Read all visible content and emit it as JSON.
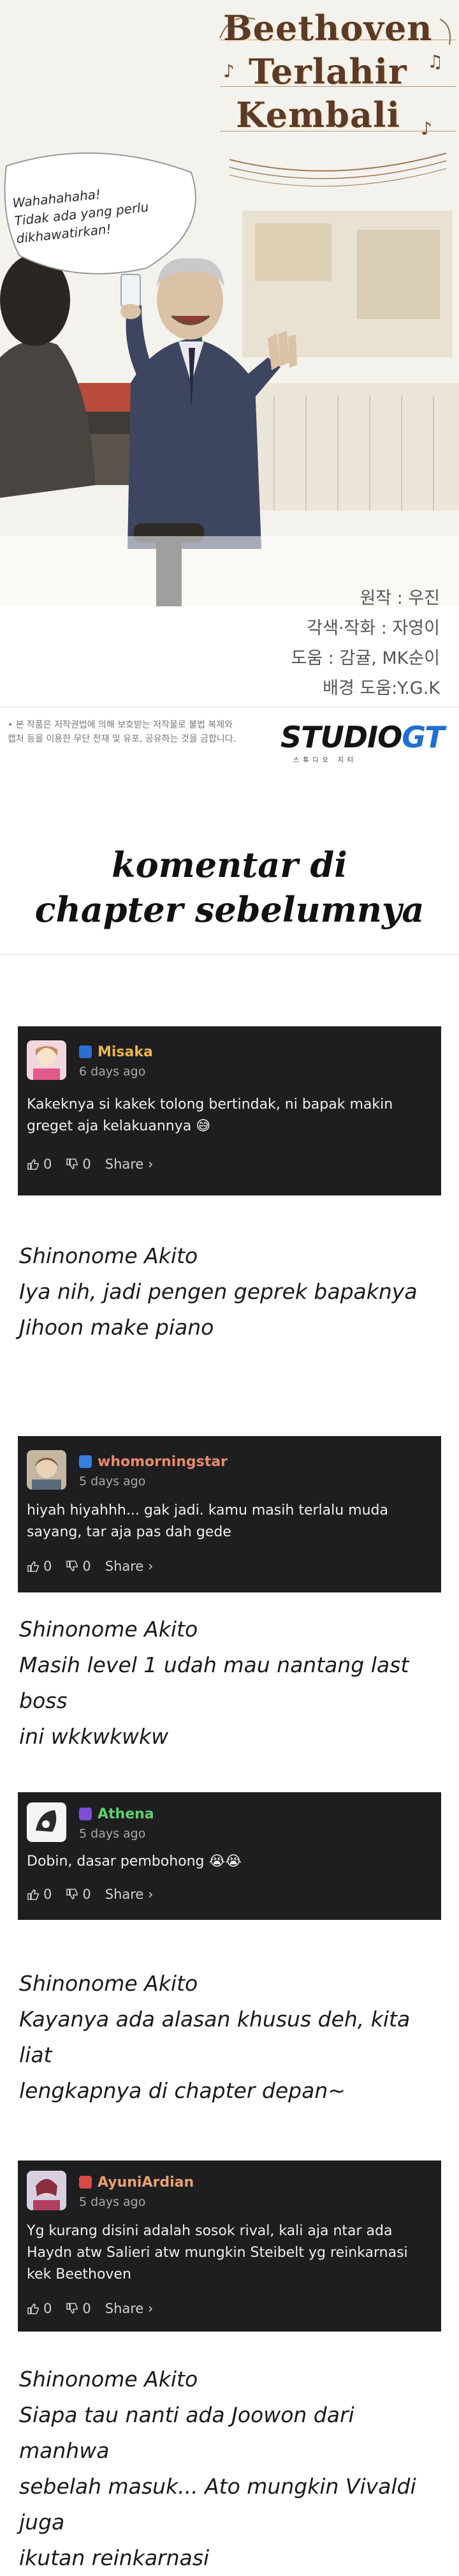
{
  "title_art": {
    "lines": [
      "Beethoven",
      "Terlahir",
      "Kembali"
    ],
    "speech_bubble": [
      "Wahahahaha!",
      "Tidak ada yang perlu",
      "dikhawatirkan!"
    ]
  },
  "credits": [
    "원작 : 우진",
    "각색·작화 : 자영이",
    "도움 : 감귤, MK순이",
    "배경 도움:Y.G.K"
  ],
  "notice": [
    "• 본 작품은 저작권법에 의해 보호받는 저작물로 불법 복제와",
    "캡처 등을 이용한 무단 전재 및 유포, 공유하는 것을 금합니다."
  ],
  "studio": {
    "name_black": "STUDIO",
    "name_blue": "GT",
    "sub": "스튜디오 지티"
  },
  "section_heading": [
    "komentar di",
    "chapter sebelumnya"
  ],
  "comments": [
    {
      "username": "Misaka",
      "age": "6 days ago",
      "body": [
        "Kakeknya si kakek tolong bertindak, ni bapak makin",
        "greget aja kelakuannya 😅"
      ],
      "likes": "0",
      "dislikes": "0",
      "share": "Share ›",
      "name_color": "#e9b54a",
      "badge_color": "#2d6fd1"
    },
    {
      "username": "whomorningstar",
      "age": "5 days ago",
      "body": [
        "hiyah hiyahhh... gak jadi. kamu masih terlalu muda",
        "sayang, tar aja pas dah gede"
      ],
      "likes": "0",
      "dislikes": "0",
      "share": "Share ›",
      "name_color": "#e88a6a",
      "badge_color": "#3a7de0"
    },
    {
      "username": "Athena",
      "age": "5 days ago",
      "body": [
        "Dobin, dasar pembohong 😭😭"
      ],
      "likes": "0",
      "dislikes": "0",
      "share": "Share ›",
      "name_color": "#5fd06e",
      "badge_color": "#7b4fd6"
    },
    {
      "username": "AyuniArdian",
      "age": "5 days ago",
      "body": [
        "Yg kurang disini adalah sosok rival, kali aja ntar ada",
        "Haydn atw Salieri atw mungkin Steibelt yg reinkarnasi",
        "kek Beethoven"
      ],
      "likes": "0",
      "dislikes": "0",
      "share": "Share ›",
      "name_color": "#e8a070",
      "badge_color": "#d84a4a"
    }
  ],
  "replies": [
    {
      "name": "Shinonome Akito",
      "lines": [
        "Iya nih, jadi pengen geprek bapaknya",
        "Jihoon make piano"
      ]
    },
    {
      "name": "Shinonome Akito",
      "lines": [
        "Masih level 1 udah mau nantang last boss",
        "ini wkkwkwkw"
      ]
    },
    {
      "name": "Shinonome Akito",
      "lines": [
        "Kayanya ada alasan khusus deh, kita liat",
        "lengkapnya di chapter depan~"
      ]
    },
    {
      "name": "Shinonome Akito",
      "lines": [
        "Siapa tau nanti ada Joowon dari manhwa",
        "sebelah masuk... Ato mungkin Vivaldi juga",
        "ikutan reinkarnasi"
      ]
    }
  ]
}
